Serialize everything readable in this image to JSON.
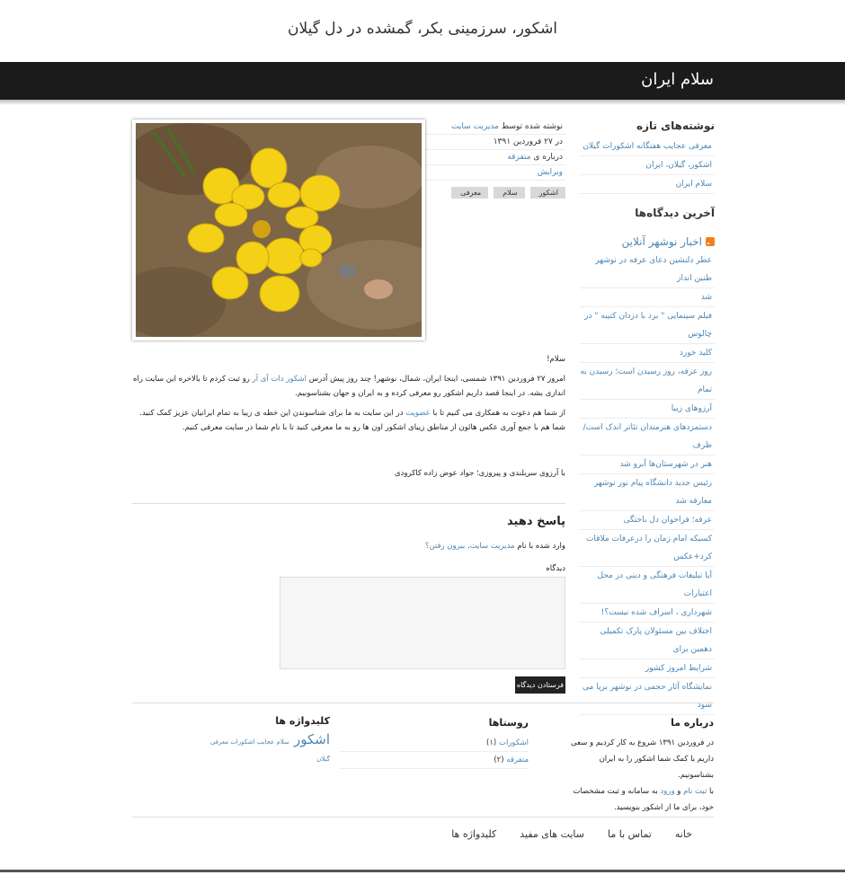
{
  "site": {
    "title": "اشکور، سرزمینی بکر، گمشده در دل گیلان",
    "banner_title": "سلام ایران"
  },
  "sidebar": {
    "recent_posts_title": "نوشته‌های تازه",
    "recent_posts": [
      "معرفی عجایب هفتگانه اشکورات گیلان",
      "اشکور، گیلان، ایران",
      "سلام ایران"
    ],
    "recent_comments_title": "آخرین دیدگاه‌ها",
    "rss_title": "اخبار نوشهر آنلاین",
    "news": [
      "عطر دلنشین دعای عرفه در نوشهر طنین انداز",
      "شد",
      "فیلم سینمایی \" برد با دزدان کتیبه \" در چالوس",
      "کلید خورد",
      "روز عرفه، روز رسیدن است؛ رسیدن به تمام",
      "آرزوهای زیبا",
      "دستمزدهای هنرمندان تئاتر اندک است/ ظرف",
      "هنر در شهرستان‌ها آبرو شد",
      "رئیس جدید دانشگاه پیام نور نوشهر معارفه شد",
      "عرفه؛ فراخوان دل باختگی",
      "کسیکه امام زمان را درعرفات ملاقات کرد+عکس",
      "آیا تبلیغات فرهنگی و دینی در محل اعتبارات",
      "شهرداری ، اسراف شده نیست؟!",
      "اختلاف بین مسئولان پارک تکمیلی دهمین برای",
      "شرایط امروز کشور",
      "نمایشگاه آثار حجمی در نوشهر برپا می شود"
    ]
  },
  "meta": {
    "author_prefix": "نوشته شده توسط",
    "author": "مدیریت سایت",
    "date": "در ۲۷ فروردین ۱۳۹۱",
    "category_prefix": "درباره ی",
    "category": "متفرقه",
    "edit": "ویرایش",
    "tags": [
      "اشکور",
      "سلام",
      "معرفی"
    ]
  },
  "post": {
    "greeting": "سلام!",
    "p1_start": "امروز ۲۷ فروردین ۱۳۹۱ شمسی، اینجا ایران، شمال، نوشهر! چند روز پیش آدرس ",
    "p1_link": "اشکور دات آی آر",
    "p1_end": " رو ثبت کردم تا بالاخره این سایت راه اندازی بشه. در اینجا قصد داریم اشکور رو معرفی کرده و به ایران و جهان بشناسونیم.",
    "p2_start": "از شما هم دعوت به همکاری می کنیم تا با ",
    "p2_link": "عضویت",
    "p2_end": " در این سایت به ما برای شناسوندن این خطه ی زیبا به تمام ایرانیان عزیز کمک کنید. شما هم با جمع آوری عکس هائون از مناطق زیبای اشکور اون ها رو به ما معرفی کنید تا با نام شما در سایت معرفی کنیم.",
    "signature": "با آرزوی سربلندی و پیروزی؛ جواد عوض زاده کاکرودی"
  },
  "reply": {
    "title": "پاسخ دهید",
    "logged_prefix": "وارد شده با نام",
    "logged_name": "مدیریت سایت",
    "logout": "بیرون رفتن؟",
    "comment_label": "دیدگاه",
    "submit_label": "فرستادن دیدگاه"
  },
  "footer": {
    "about_title": "درباره ما",
    "about_line1_start": "در فروردین ۱۳۹۱ شروع به کار کردیم و سعی داریم با کمک شما ",
    "about_line1_end": "اشکور را به ایران بشناسونیم.",
    "about_line2_prefix": "با ",
    "about_register": "ثبت نام",
    "about_or": " و ",
    "about_login": "ورود",
    "about_line2_end": " به سامانه و ثبت مشخصات خود، برای ما از اشکور بنویسید.",
    "villages_title": "روستاها",
    "villages": [
      {
        "name": "اشکورات",
        "count": "(۱)"
      },
      {
        "name": "متفرقه",
        "count": "(۲)"
      }
    ],
    "tagcloud_title": "کلیدواژه ها",
    "tag_big": "اشکور",
    "tag_small": "سلام عجایب اشکورات معرفی گیلان"
  },
  "nav": [
    "خانه",
    "تماس با ما",
    "سایت های مفید",
    "کلیدواژه ها"
  ]
}
